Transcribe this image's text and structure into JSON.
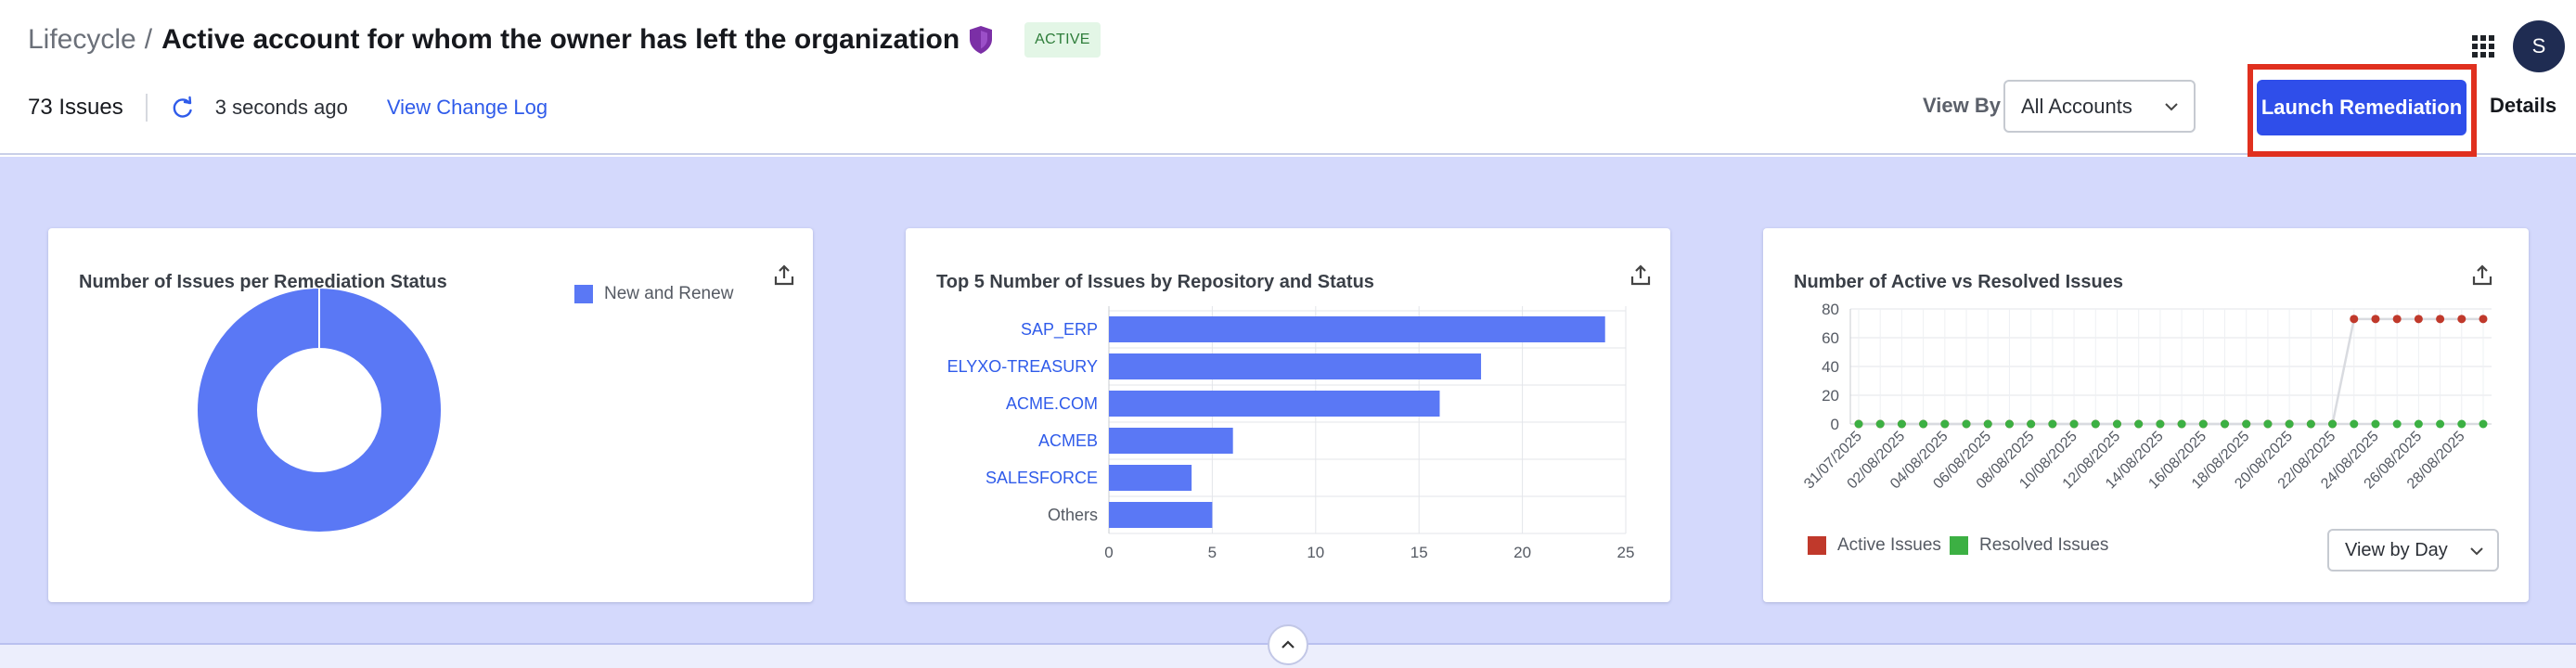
{
  "header": {
    "breadcrumb": "Lifecycle",
    "breadcrumb_sep": "/",
    "title": "Active account for whom the owner has left the organization",
    "status_badge": "ACTIVE",
    "issues_count": "73 Issues",
    "refreshed": "3 seconds ago",
    "change_log_link": "View Change Log",
    "view_by_label": "View By",
    "view_by_value": "All Accounts",
    "launch_button": "Launch Remediation",
    "details_link": "Details",
    "avatar_initial": "S",
    "colors": {
      "accent": "#2f4eea",
      "highlight": "#e0301f",
      "shield": "#7b2fa6"
    }
  },
  "charts": {
    "donut": {
      "title": "Number of Issues per Remediation Status",
      "legend": "New and Renew",
      "color": "#5a78f5"
    },
    "bar": {
      "title": "Top 5 Number of Issues by Repository and Status",
      "color": "#5a78f5"
    },
    "line": {
      "title": "Number of Active vs Resolved Issues",
      "legend_active": "Active Issues",
      "legend_resolved": "Resolved Issues",
      "active_color": "#c0392b",
      "resolved_color": "#3cb043",
      "view_by_day": "View by Day"
    }
  },
  "chart_data": [
    {
      "type": "pie",
      "title": "Number of Issues per Remediation Status",
      "categories": [
        "New and Renew"
      ],
      "values": [
        73
      ],
      "donut": true
    },
    {
      "type": "bar",
      "orientation": "horizontal",
      "title": "Top 5 Number of Issues by Repository and Status",
      "categories": [
        "SAP_ERP",
        "ELYXO-TREASURY",
        "ACME.COM",
        "ACMEB",
        "SALESFORCE",
        "Others"
      ],
      "values": [
        24,
        18,
        16,
        6,
        4,
        5
      ],
      "xlim": [
        0,
        25
      ],
      "xticks": [
        "0",
        "5",
        "10",
        "15",
        "20",
        "25"
      ],
      "grid": true
    },
    {
      "type": "line",
      "title": "Number of Active vs Resolved Issues",
      "x": [
        "31/07/2025",
        "01/08/2025",
        "02/08/2025",
        "03/08/2025",
        "04/08/2025",
        "05/08/2025",
        "06/08/2025",
        "07/08/2025",
        "08/08/2025",
        "09/08/2025",
        "10/08/2025",
        "11/08/2025",
        "12/08/2025",
        "13/08/2025",
        "14/08/2025",
        "15/08/2025",
        "16/08/2025",
        "17/08/2025",
        "18/08/2025",
        "19/08/2025",
        "20/08/2025",
        "21/08/2025",
        "22/08/2025",
        "23/08/2025",
        "24/08/2025",
        "25/08/2025",
        "26/08/2025",
        "27/08/2025",
        "28/08/2025",
        "29/08/2025"
      ],
      "xticks": [
        "31/07/2025",
        "02/08/2025",
        "04/08/2025",
        "06/08/2025",
        "08/08/2025",
        "10/08/2025",
        "12/08/2025",
        "14/08/2025",
        "16/08/2025",
        "18/08/2025",
        "20/08/2025",
        "22/08/2025",
        "24/08/2025",
        "26/08/2025",
        "28/08/2025"
      ],
      "series": [
        {
          "name": "Active Issues",
          "values": [
            0,
            0,
            0,
            0,
            0,
            0,
            0,
            0,
            0,
            0,
            0,
            0,
            0,
            0,
            0,
            0,
            0,
            0,
            0,
            0,
            0,
            0,
            0,
            73,
            73,
            73,
            73,
            73,
            73,
            73
          ]
        },
        {
          "name": "Resolved Issues",
          "values": [
            0,
            0,
            0,
            0,
            0,
            0,
            0,
            0,
            0,
            0,
            0,
            0,
            0,
            0,
            0,
            0,
            0,
            0,
            0,
            0,
            0,
            0,
            0,
            0,
            0,
            0,
            0,
            0,
            0,
            0
          ]
        }
      ],
      "ylim": [
        0,
        80
      ],
      "yticks": [
        "0",
        "20",
        "40",
        "60",
        "80"
      ],
      "grid": true,
      "legend_position": "bottom-left"
    }
  ]
}
